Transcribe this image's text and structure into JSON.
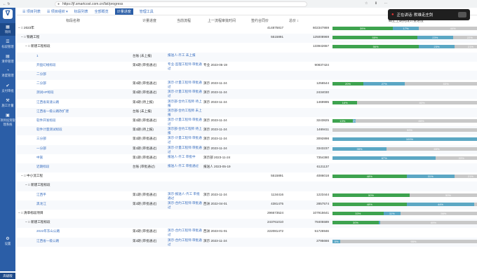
{
  "browser": {
    "url": "https://jf.smartcost.com.cn/list/progress",
    "nav": "← ↻",
    "icons": "☆ ⬇ ⋯"
  },
  "sidebar": {
    "items": [
      {
        "label": "项目",
        "glyph": "▦",
        "active": true
      },
      {
        "label": "标段管理",
        "glyph": "☰"
      },
      {
        "label": "清单管理",
        "glyph": "▤"
      },
      {
        "label": "进度管理",
        "glyph": "◔"
      },
      {
        "label": "支付审批",
        "glyph": "✔"
      },
      {
        "label": "施工计量",
        "glyph": "⚒"
      },
      {
        "label": "项目投资管理系统",
        "glyph": "▣"
      },
      {
        "label": "设置",
        "glyph": "⚙"
      }
    ],
    "bottom": "高级版"
  },
  "tabs": [
    "☰ 项目列表",
    "☰ 项目组织 ▾",
    "标段列表",
    "全部概览",
    "计量进度",
    "管理工具"
  ],
  "active_tab": 4,
  "headers": [
    "标段名称",
    "计量进度",
    "当前流程",
    "上一流程审批时间",
    "签约合同价",
    "总价 ↕",
    "截止上期完成计量进度"
  ],
  "toast": {
    "text": "正在讲话: 默维走庄剑"
  },
  "rows": [
    {
      "name": "− □ 2023年",
      "indent": 2,
      "style": "bold",
      "contract": "414875817",
      "total": "602347869",
      "segs": [
        [
          39,
          "g1",
          "39%"
        ],
        [
          17,
          "b1",
          "17%"
        ],
        [
          44,
          "x1",
          "44%"
        ]
      ]
    },
    {
      "name": "− □ 铁路工程",
      "indent": 6,
      "style": "bold",
      "contract": "5515891",
      "total": "125008969",
      "segs": [
        [
          55,
          "g1",
          "55%"
        ],
        [
          23,
          "b1",
          "23%"
        ],
        [
          22,
          "x1",
          "22%"
        ]
      ]
    },
    {
      "name": "− □ 新建工程标段",
      "indent": 12,
      "style": "bold",
      "total": "133942657",
      "segs": [
        [
          56,
          "g1",
          "56%"
        ],
        [
          23,
          "b1",
          "23%"
        ],
        [
          21,
          "x1",
          "21%"
        ]
      ]
    },
    {
      "name": "1",
      "indent": 28,
      "style": "link",
      "prog": "台账 (未上报)",
      "flow": "报送人-齐工 未上报"
    },
    {
      "name": "开盘幻线标段",
      "indent": 28,
      "style": "link",
      "prog": "第5期 (审批通过)",
      "flow": "专业-监理工程师 审批通过",
      "date": "专业 2023-05-19",
      "total": "90837424"
    },
    {
      "name": "二分部",
      "indent": 28,
      "style": "link"
    },
    {
      "name": "二分部",
      "indent": 28,
      "style": "link",
      "prog": "第3期 (审批通过)",
      "flow": "演示-计量工程师 审批通过",
      "date": "演示 2023-11-24",
      "total": "1256544",
      "segs": [
        [
          20,
          "g1",
          "20%"
        ],
        [
          27,
          "b1",
          "27%"
        ],
        [
          53,
          "x1",
          "53%"
        ]
      ]
    },
    {
      "name": "测试HP标段",
      "indent": 28,
      "style": "link",
      "prog": "第3期 (审批通过)",
      "flow": "演示-计量工程师 审批通过",
      "date": "演示 2023-11-24",
      "total": "2434030"
    },
    {
      "name": "江西省高速公路",
      "indent": 28,
      "style": "link",
      "prog": "第3期 (待上报)",
      "flow": "演示部-合约工程师 待上报",
      "date": "演示 2023-11-24",
      "total": "1469995",
      "segs": [
        [
          16,
          "g1",
          "16%"
        ],
        [
          84,
          "x1",
          "83%"
        ]
      ]
    },
    {
      "name": "江西省一级公路改扩建",
      "indent": 28,
      "style": "link",
      "prog": "台账 (未上报)",
      "flow": "演示部-合约工程师 未上报"
    },
    {
      "name": "软件开发标段",
      "indent": 28,
      "style": "link",
      "prog": "第3期 (审批通过)",
      "flow": "演示-计量工程师 审批通过",
      "date": "演示 2023-11-24",
      "total": "3243825",
      "segs": [
        [
          13,
          "g1",
          "13%"
        ],
        [
          2,
          "b1",
          "2%"
        ],
        [
          85,
          "x1",
          "85%"
        ]
      ]
    },
    {
      "name": "软件计量测试标段",
      "indent": 28,
      "style": "link",
      "prog": "第3期 (待上报)",
      "flow": "演示部-合约工程师 待上报",
      "date": "演示 2023-11-24",
      "total": "1469411",
      "segs": [
        [
          100,
          "x1",
          "99%"
        ]
      ]
    },
    {
      "name": "三分部",
      "indent": 28,
      "style": "link",
      "prog": "第3期 (审批通过)",
      "flow": "演示-计量工程师 审批通过",
      "date": "演示 2023-11-24",
      "total": "3092898",
      "segs": [
        [
          100,
          "b1",
          "100%"
        ]
      ]
    },
    {
      "name": "一分部",
      "indent": 28,
      "style": "link",
      "prog": "第3期 (审批通过)",
      "flow": "演示-计量工程师 审批通过",
      "date": "演示 2023-11-24",
      "total": "3343237",
      "segs": [
        [
          35,
          "b1",
          "35%"
        ],
        [
          65,
          "x1",
          "65%"
        ]
      ]
    },
    {
      "name": "中族",
      "indent": 28,
      "style": "link",
      "prog": "第1期 (审批通过)",
      "flow": "报送人-齐工 审批中",
      "date": "演示部 2023-11-24",
      "total": "7354380",
      "segs": [
        [
          67,
          "b1",
          "67%"
        ],
        [
          33,
          "x1",
          "33%"
        ]
      ]
    },
    {
      "name": "近期标段",
      "indent": 28,
      "style": "link",
      "prog": "台账 (审批通过)",
      "flow": "报送人-齐工 审批通过",
      "date": "报送人 2023-05-19",
      "total": "6121137"
    },
    {
      "name": "− □ 中小流工程",
      "indent": 6,
      "style": "bold",
      "contract": "5515891",
      "total": "4086018",
      "segs": [
        [
          48,
          "g1",
          "48%"
        ],
        [
          31,
          "b1",
          "31%"
        ],
        [
          21,
          "x1",
          "21%"
        ]
      ]
    },
    {
      "name": "− □ 新建工程标段",
      "indent": 12,
      "style": "bold"
    },
    {
      "name": "江西平",
      "indent": 28,
      "style": "link",
      "prog": "第1期 (审批通过)",
      "flow": "演示-报送人-齐工 审批通过",
      "date": "演示 2023-11-24",
      "contract": "1134416",
      "total": "1223444",
      "segs": [
        [
          50,
          "g1",
          "50%"
        ],
        [
          50,
          "x1",
          "50%"
        ]
      ]
    },
    {
      "name": "黑龙江",
      "indent": 28,
      "style": "link",
      "prog": "第3期 (审批通过)",
      "flow": "演示-合约工程师 审批通过",
      "date": "西洲 2022-04-01",
      "contract": "4381475",
      "total": "2857574",
      "segs": [
        [
          48,
          "g1",
          "48%"
        ],
        [
          44,
          "b1",
          "44%"
        ],
        [
          8,
          "x1",
          "8%"
        ]
      ]
    },
    {
      "name": "− □ 清单标段项目",
      "indent": 2,
      "style": "bold",
      "contract": "296673524",
      "total": "107915641",
      "segs": [
        [
          33,
          "g1",
          "33%"
        ],
        [
          11,
          "b1",
          "11%"
        ],
        [
          56,
          "x1",
          "56%"
        ]
      ]
    },
    {
      "name": "− □ 新建工程标段",
      "indent": 12,
      "style": "bold",
      "contract": "243761010",
      "total": "78405589",
      "segs": [
        [
          30,
          "g1",
          "30%"
        ],
        [
          1,
          "b1",
          ""
        ],
        [
          69,
          "x1",
          "69%"
        ]
      ]
    },
    {
      "name": "2022年东山公路",
      "indent": 28,
      "style": "link",
      "prog": "第2期 (审批通过)",
      "flow": "演示-合约工程师 审批通过",
      "date": "西洲 2023-01-01",
      "contract": "222081472",
      "total": "51726946"
    },
    {
      "name": "江西省一级公路",
      "indent": 28,
      "style": "link",
      "prog": "第3期 (审批通过)",
      "flow": "演示-合约工程师 审批通过",
      "date": "演示 2023-11-24",
      "total": "2795666",
      "segs": [
        [
          5,
          "b1",
          "5%"
        ],
        [
          95,
          "x1",
          "95%"
        ]
      ]
    }
  ]
}
